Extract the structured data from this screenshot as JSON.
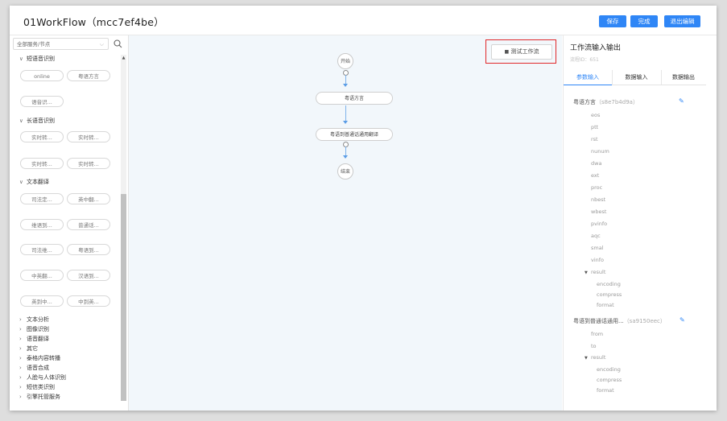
{
  "header": {
    "title": "01WorkFlow（mcc7ef4be）",
    "save_label": "保存",
    "done_label": "完成",
    "exit_label": "退出编辑"
  },
  "sidebar": {
    "filter_value": "全部服务/节点",
    "categories": {
      "short_speech": "短语音识别",
      "long_speech": "长语音识别",
      "text_translate": "文本翻译"
    },
    "short_pills": [
      "online",
      "粤语方言",
      "语音识..."
    ],
    "long_pills": [
      "实时转...",
      "实时转...",
      "实时转...",
      "实时转..."
    ],
    "trans_pills": [
      "司法定...",
      "英中翻...",
      "维语到...",
      "普通话...",
      "司法维...",
      "粤语到...",
      "中英翻...",
      "汉语到...",
      "英到中...",
      "中到英..."
    ],
    "collapsed": [
      "文本分析",
      "图像识别",
      "语音翻译",
      "其它",
      "泰格内容转播",
      "语音合成",
      "人脸与人体识别",
      "短信类识别",
      "引擎托管服务"
    ]
  },
  "canvas": {
    "test_button": "测试工作流",
    "nodes": {
      "start": "开始",
      "n1": "粤语方言",
      "n2": "粤语到普通话通用翻译",
      "end": "结束"
    }
  },
  "rightpanel": {
    "title": "工作流输入输出",
    "subtitle": "流程ID：651",
    "tabs": [
      "参数输入",
      "数据输入",
      "数据输出"
    ],
    "section1": {
      "name": "粤语方言",
      "id": "（s8e7b4d9a）"
    },
    "section1_leaves": [
      "eos",
      "ptt",
      "rst",
      "nunum",
      "dwa",
      "ext",
      "proc",
      "nbest",
      "wbest",
      "pvinfo",
      "aqc",
      "smal",
      "vinfo"
    ],
    "section1_group": "result",
    "section1_group_leaves": [
      "encoding",
      "compress",
      "format"
    ],
    "section2": {
      "name": "粤语到普通话通用...",
      "id": "（sa9150eec）"
    },
    "section2_leaves": [
      "from",
      "to"
    ],
    "section2_group": "result",
    "section2_group_leaves": [
      "encoding",
      "compress",
      "format"
    ]
  },
  "colors": {
    "accent": "#2f86f6",
    "highlight": "#e0282a",
    "canvas_bg": "#f2f7fb"
  }
}
